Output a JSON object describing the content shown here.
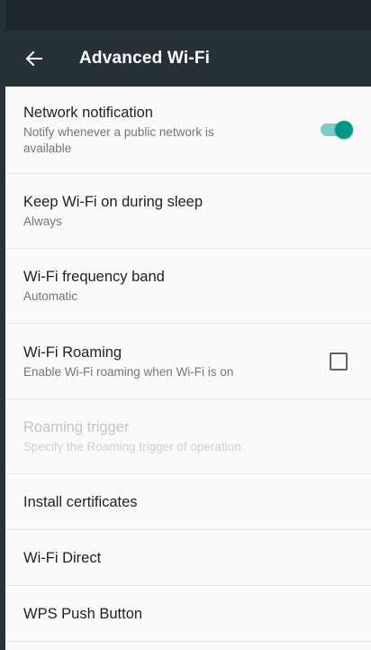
{
  "toolbar": {
    "title": "Advanced Wi-Fi",
    "back_icon": "arrow-left-icon"
  },
  "colors": {
    "toolbar": "#263238",
    "statusbar": "#1e272c",
    "accent": "#009688",
    "background": "#fafafa"
  },
  "settings": [
    {
      "title": "Network notification",
      "summary": "Notify whenever a public network is available",
      "control": "toggle",
      "on": true
    },
    {
      "title": "Keep Wi-Fi on during sleep",
      "summary": "Always"
    },
    {
      "title": "Wi-Fi frequency band",
      "summary": "Automatic"
    },
    {
      "title": "Wi-Fi Roaming",
      "summary": "Enable Wi-Fi roaming when Wi-Fi is on",
      "control": "checkbox",
      "checked": false
    },
    {
      "title": "Roaming trigger",
      "summary": "Specify the Roaming trigger of operation",
      "enabled": false
    },
    {
      "title": "Install certificates"
    },
    {
      "title": "Wi-Fi Direct"
    },
    {
      "title": "WPS Push Button"
    }
  ]
}
